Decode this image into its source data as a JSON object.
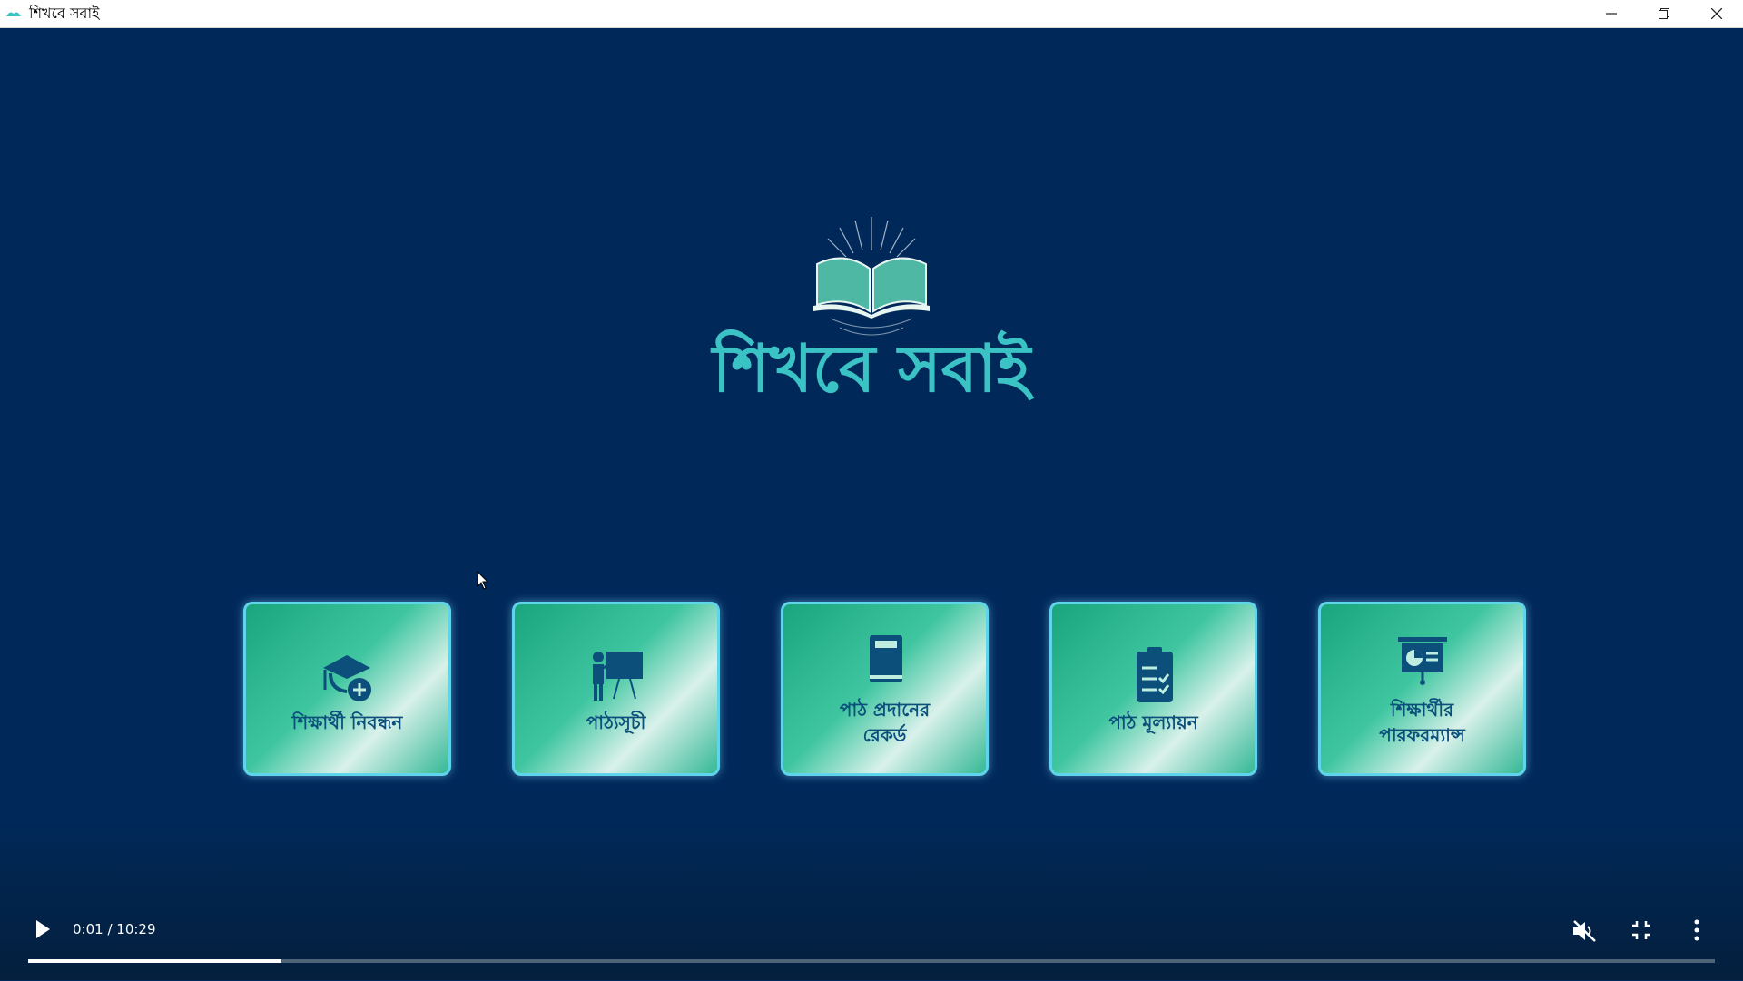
{
  "window": {
    "title": "শিখবে সবাই",
    "controls": [
      "minimize-icon",
      "restore-icon",
      "close-icon"
    ]
  },
  "logo": {
    "text": "শিখবে সবাই",
    "icon": "open-book-icon",
    "accent": "#3bc2c4"
  },
  "cards": [
    {
      "label": "শিক্ষার্থী নিবন্ধন",
      "icon": "student-register-icon"
    },
    {
      "label": "পাঠ্যসূচী",
      "icon": "teacher-board-icon"
    },
    {
      "label": "পাঠ প্রদানের\nরেকর্ড",
      "icon": "book-icon"
    },
    {
      "label": "পাঠ মূল্যায়ন",
      "icon": "checklist-icon"
    },
    {
      "label": "শিক্ষার্থীর\nপারফরম্যান্স",
      "icon": "presentation-chart-icon"
    }
  ],
  "player": {
    "time": "0:01 / 10:29",
    "progress": 0.15,
    "buttons": [
      "play-icon",
      "mute-icon",
      "exit-fullscreen-icon",
      "more-icon"
    ]
  }
}
